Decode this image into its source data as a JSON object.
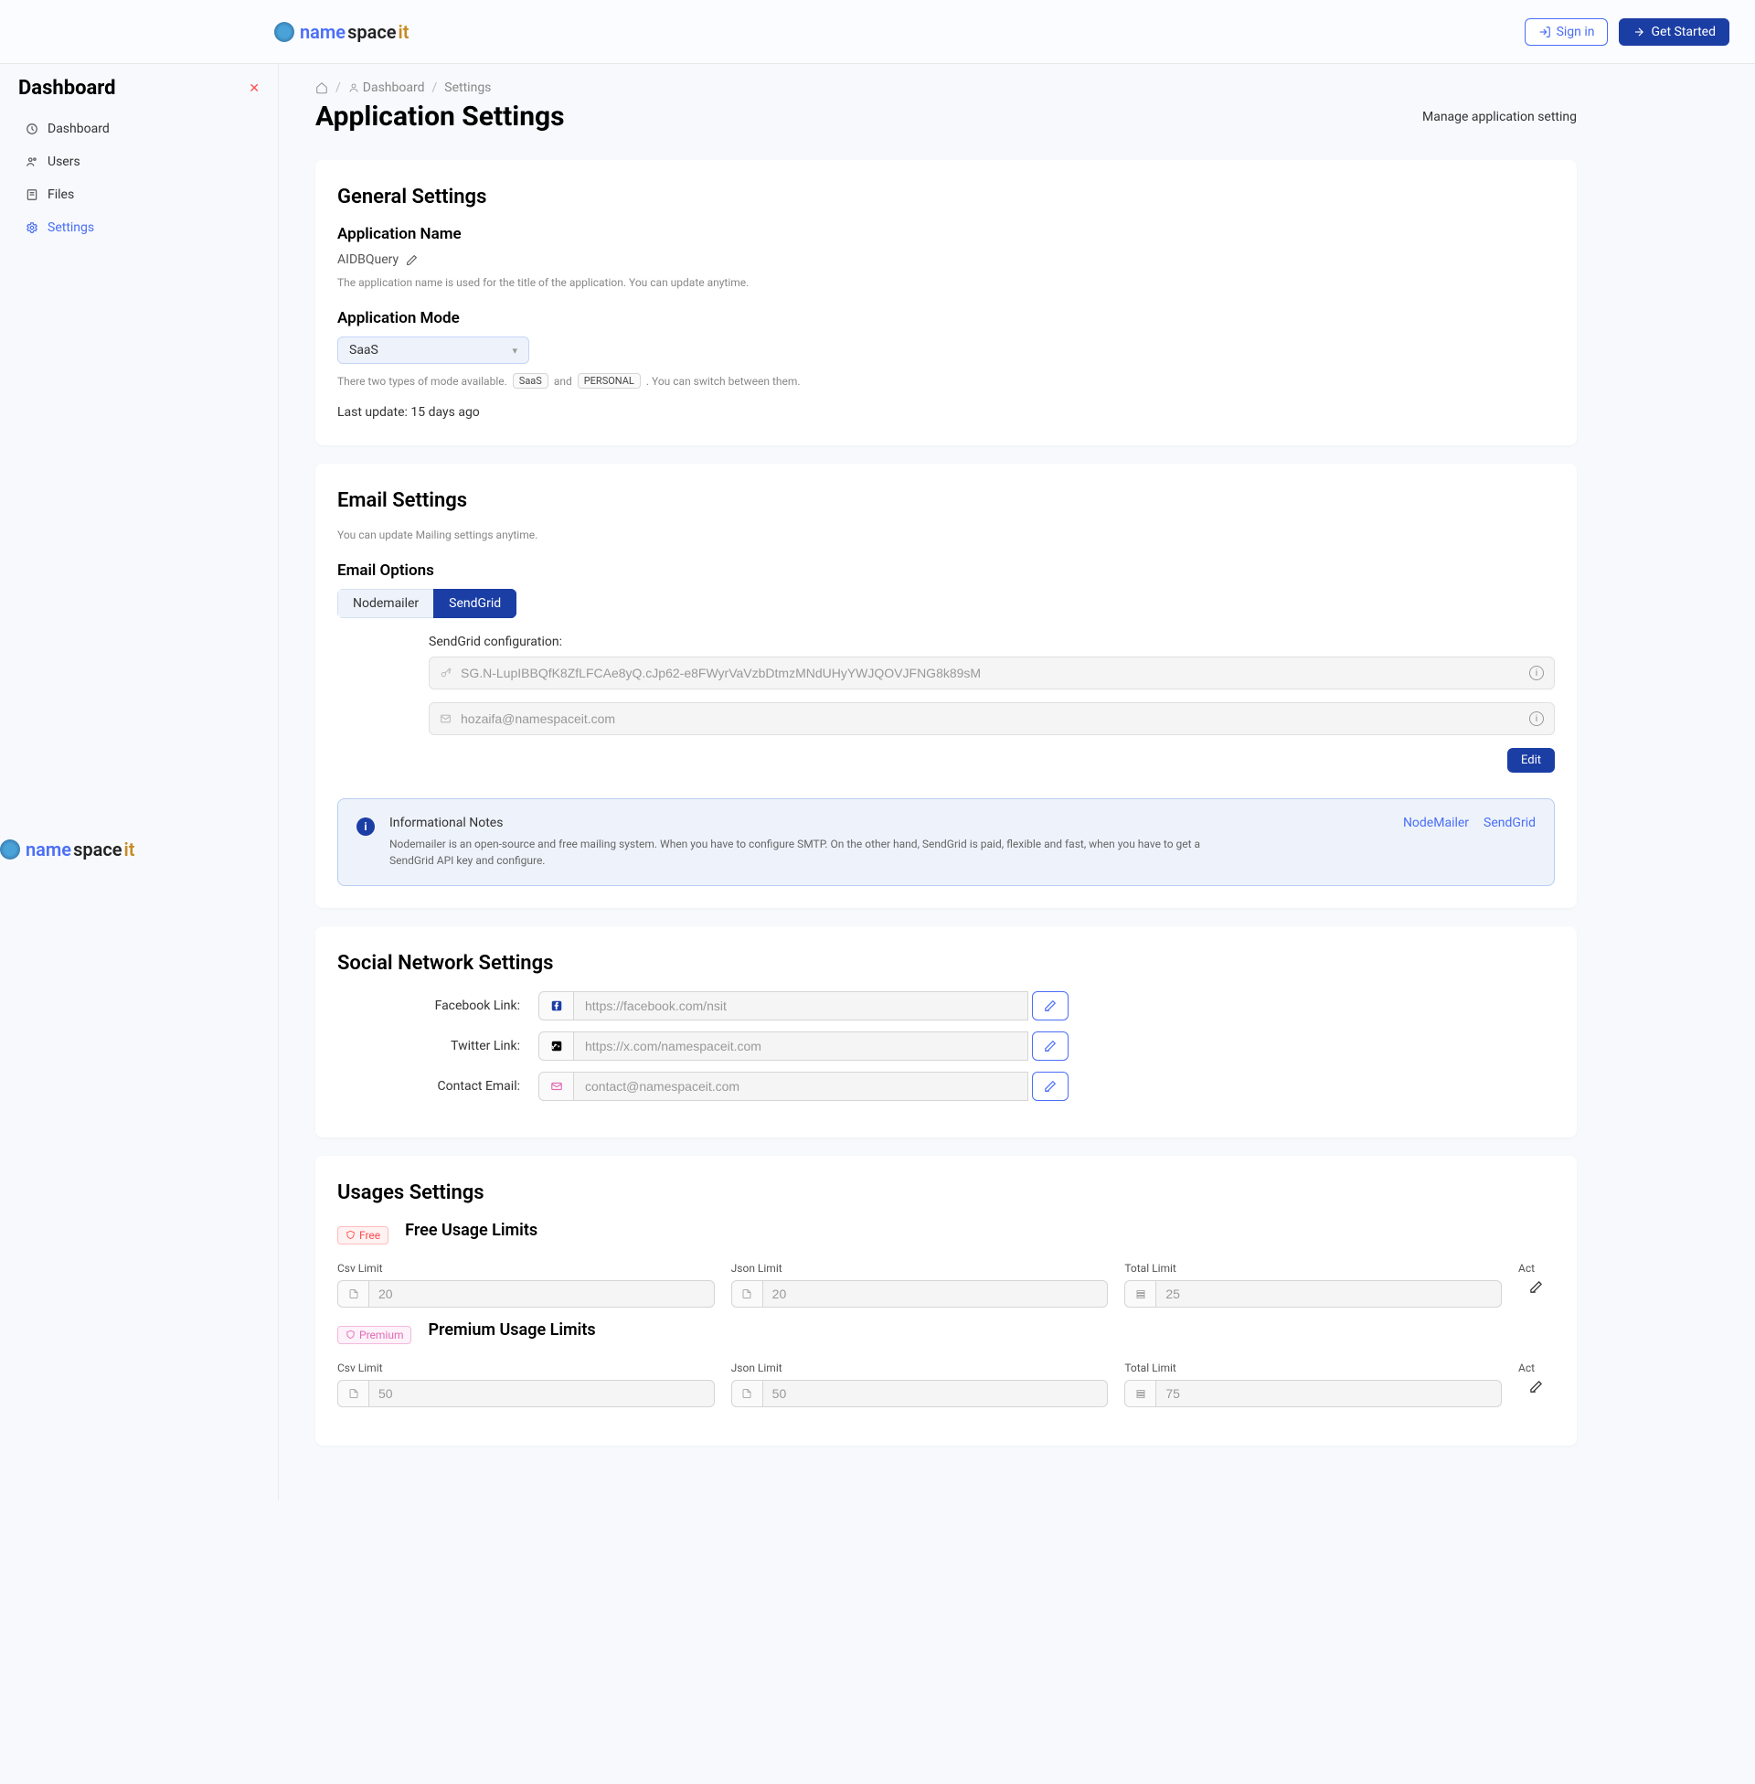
{
  "header": {
    "logo": {
      "name": "name",
      "space": "space",
      "it": " it"
    },
    "signin": "Sign in",
    "getstarted": "Get Started"
  },
  "sidebar": {
    "title": "Dashboard",
    "items": [
      {
        "label": "Dashboard"
      },
      {
        "label": "Users"
      },
      {
        "label": "Files"
      },
      {
        "label": "Settings"
      }
    ]
  },
  "breadcrumb": {
    "dashboard": "Dashboard",
    "settings": "Settings"
  },
  "page": {
    "title": "Application Settings",
    "subtitle": "Manage application setting"
  },
  "general": {
    "heading": "General Settings",
    "app_name_label": "Application Name",
    "app_name_value": "AIDBQuery",
    "app_name_help": "The application name is used for the title of the application. You can update anytime.",
    "mode_label": "Application Mode",
    "mode_value": "SaaS",
    "mode_help_pre": "There two types of mode available.",
    "mode_tag1": "SaaS",
    "mode_and": "and",
    "mode_tag2": "PERSONAL",
    "mode_help_post": ". You can switch between them.",
    "last_update": "Last update: 15 days ago"
  },
  "email": {
    "heading": "Email Settings",
    "help": "You can update Mailing settings anytime.",
    "options_label": "Email Options",
    "opt1": "Nodemailer",
    "opt2": "SendGrid",
    "config_label": "SendGrid configuration:",
    "api_key": "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",
    "from_email": "hozaifa@namespaceit.com",
    "edit": "Edit",
    "alert_title": "Informational Notes",
    "alert_desc": "Nodemailer is an open-source and free mailing system. When you have to configure SMTP. On the other hand, SendGrid is paid, flexible and fast, when you have to get a SendGrid API key and configure.",
    "alert_link1": "NodeMailer",
    "alert_link2": "SendGrid"
  },
  "social": {
    "heading": "Social Network Settings",
    "fb_label": "Facebook Link:",
    "fb_value": "https://facebook.com/nsit",
    "tw_label": "Twitter Link:",
    "tw_value": "https://x.com/namespaceit.com",
    "em_label": "Contact Email:",
    "em_value": "contact@namespaceit.com"
  },
  "usages": {
    "heading": "Usages Settings",
    "free_tag": "Free",
    "free_title": "Free Usage Limits",
    "prem_tag": "Premium",
    "prem_title": "Premium Usage Limits",
    "col_csv": "Csv Limit",
    "col_json": "Json Limit",
    "col_total": "Total Limit",
    "col_act": "Act",
    "free_csv": "20",
    "free_json": "20",
    "free_total": "25",
    "prem_csv": "50",
    "prem_json": "50",
    "prem_total": "75"
  }
}
